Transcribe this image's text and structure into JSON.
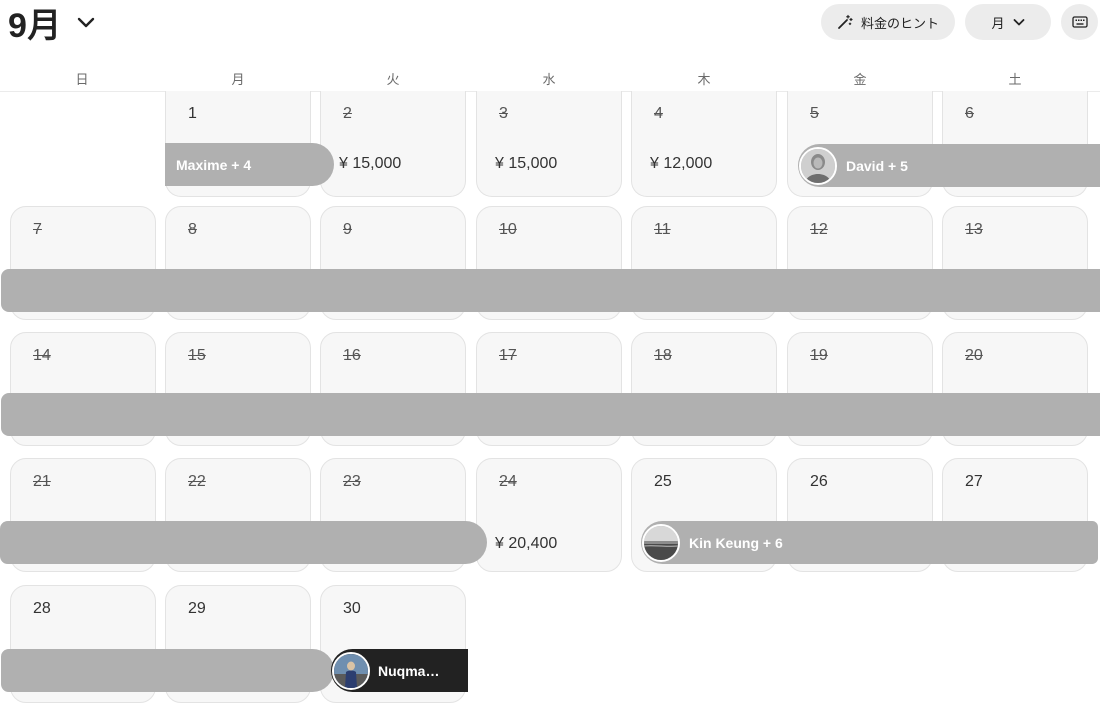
{
  "header": {
    "month_title": "9月",
    "price_hint_button": "料金のヒント",
    "view_button": "月"
  },
  "weekdays": [
    "日",
    "月",
    "火",
    "水",
    "木",
    "金",
    "土"
  ],
  "days": [
    {
      "label": "1",
      "past": false,
      "price": ""
    },
    {
      "label": "2",
      "past": true,
      "price": "¥ 15,000"
    },
    {
      "label": "3",
      "past": true,
      "price": "¥ 15,000"
    },
    {
      "label": "4",
      "past": true,
      "price": "¥ 12,000"
    },
    {
      "label": "5",
      "past": true,
      "price": ""
    },
    {
      "label": "6",
      "past": true,
      "price": ""
    },
    {
      "label": "7",
      "past": true,
      "price": ""
    },
    {
      "label": "8",
      "past": true,
      "price": ""
    },
    {
      "label": "9",
      "past": true,
      "price": ""
    },
    {
      "label": "10",
      "past": true,
      "price": ""
    },
    {
      "label": "11",
      "past": true,
      "price": ""
    },
    {
      "label": "12",
      "past": true,
      "price": ""
    },
    {
      "label": "13",
      "past": true,
      "price": ""
    },
    {
      "label": "14",
      "past": true,
      "price": ""
    },
    {
      "label": "15",
      "past": true,
      "price": ""
    },
    {
      "label": "16",
      "past": true,
      "price": ""
    },
    {
      "label": "17",
      "past": true,
      "price": ""
    },
    {
      "label": "18",
      "past": true,
      "price": ""
    },
    {
      "label": "19",
      "past": true,
      "price": ""
    },
    {
      "label": "20",
      "past": true,
      "price": ""
    },
    {
      "label": "21",
      "past": true,
      "price": ""
    },
    {
      "label": "22",
      "past": true,
      "price": ""
    },
    {
      "label": "23",
      "past": true,
      "price": ""
    },
    {
      "label": "24",
      "past": true,
      "price": "¥ 20,400"
    },
    {
      "label": "25",
      "past": false,
      "price": ""
    },
    {
      "label": "26",
      "past": false,
      "price": ""
    },
    {
      "label": "27",
      "past": false,
      "price": ""
    },
    {
      "label": "28",
      "past": false,
      "price": ""
    },
    {
      "label": "29",
      "past": false,
      "price": ""
    },
    {
      "label": "30",
      "past": false,
      "price": ""
    }
  ],
  "reservations": {
    "maxime": {
      "guest": "Maxime + 4",
      "avatar": false
    },
    "david": {
      "guest": "David + 5",
      "avatar": true,
      "avatar_icon": "guest-avatar-photo"
    },
    "week2": {
      "guest": "",
      "avatar": false
    },
    "week3": {
      "guest": "",
      "avatar": false
    },
    "week4_a": {
      "guest": "",
      "avatar": false
    },
    "kin": {
      "guest": "Kin Keung + 6",
      "avatar": true,
      "avatar_icon": "guest-avatar-photo"
    },
    "week5_a": {
      "guest": "",
      "avatar": false
    },
    "nuqma": {
      "guest": "Nuqma…",
      "avatar": true,
      "avatar_icon": "guest-avatar-photo",
      "highlighted": true
    }
  },
  "colors": {
    "reservation_bar": "#b0b0b0",
    "reservation_bar_selected": "#222222",
    "cell_background": "#f7f7f7"
  }
}
